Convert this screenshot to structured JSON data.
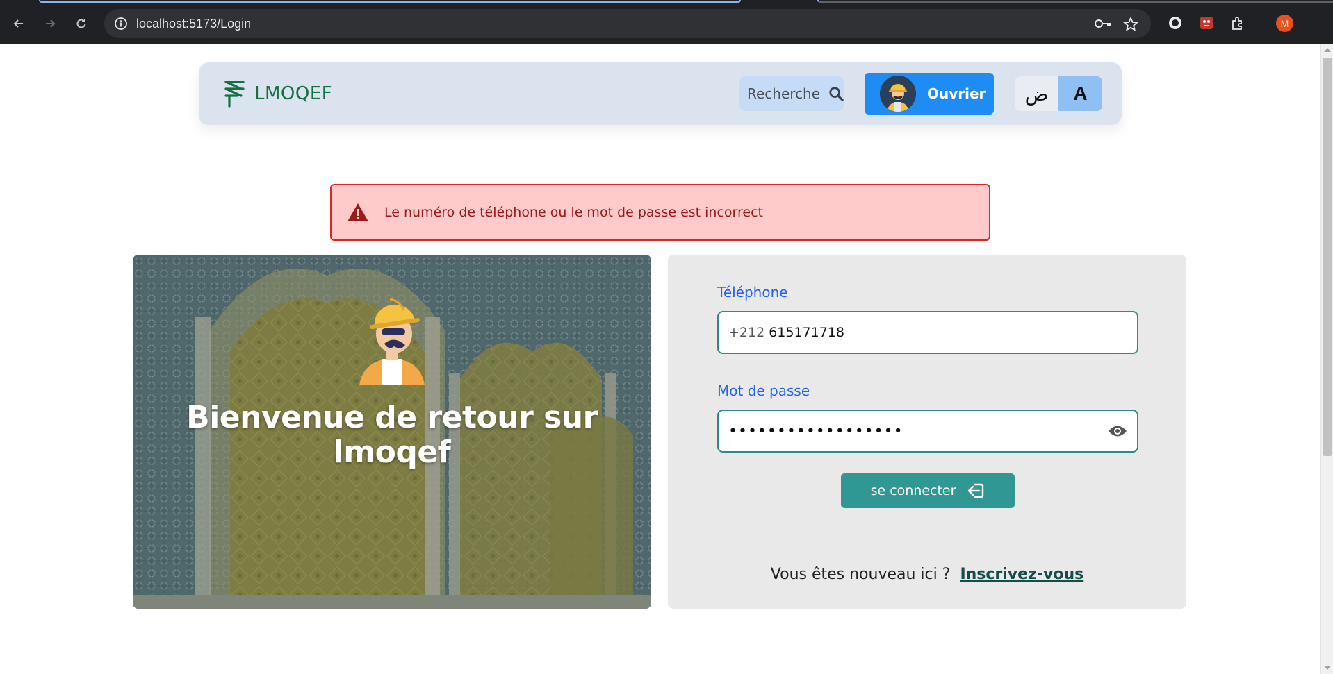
{
  "browser": {
    "url": "localhost:5173/Login",
    "profile_initial": "M"
  },
  "navbar": {
    "brand": "LMOQEF",
    "search_label": "Recherche",
    "role_label": "Ouvrier",
    "lang_arabic": "ض",
    "lang_latin": "A"
  },
  "alert": {
    "message": "Le numéro de téléphone ou le mot de passe est incorrect"
  },
  "hero": {
    "title_line1": "Bienvenue de retour sur",
    "title_line2": "lmoqef"
  },
  "form": {
    "phone_label": "Téléphone",
    "phone_prefix": "+212",
    "phone_value": "615171718",
    "password_label": "Mot de passe",
    "password_masked": "••••••••••••••••••",
    "submit_label": "se connecter",
    "signup_question": "Vous êtes nouveau ici ?",
    "signup_link": "Inscrivez-vous"
  },
  "colors": {
    "navbar_bg": "#dbe3ef",
    "brand": "#14703f",
    "role_button": "#1e8cf2",
    "alert_bg": "#fecaca",
    "alert_border": "#dc2626",
    "field_border": "#2e8b8b",
    "submit": "#319795",
    "label": "#2563eb"
  }
}
